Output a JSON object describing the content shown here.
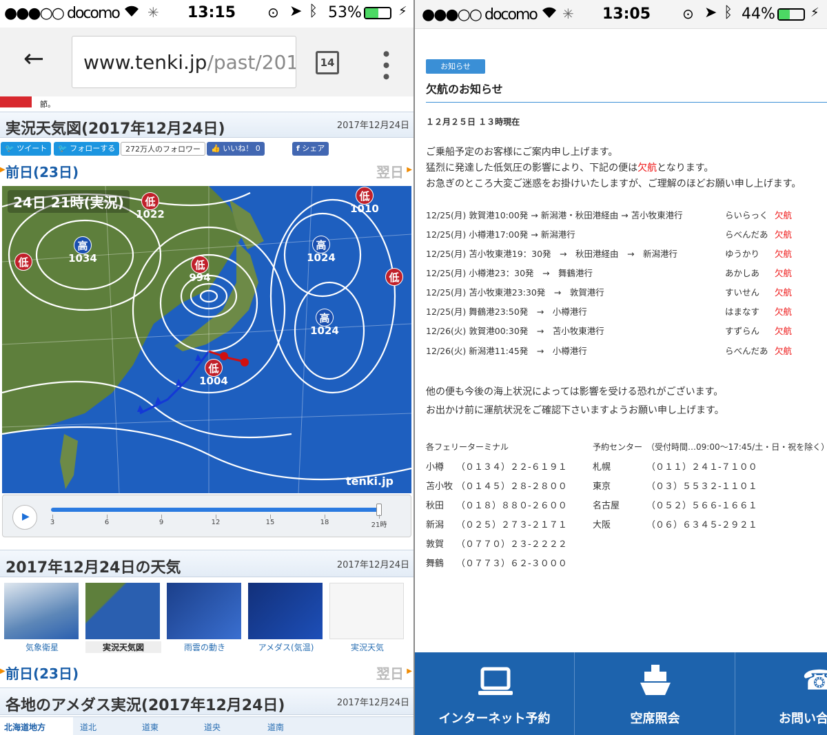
{
  "left_status": {
    "carrier": "●●●○○ docomo",
    "time": "13:15",
    "battery": "53%",
    "battery_level": 0.53
  },
  "browser": {
    "url_host": "www.tenki.jp",
    "url_path": "/past/201",
    "tab_count": "14"
  },
  "partial_line": "節。",
  "section1": {
    "title": "実況天気図(2017年12月24日)",
    "date": "2017年12月24日"
  },
  "social": {
    "tweet": "ツイート",
    "follow": "フォローする",
    "followers": "272万人のフォロワー",
    "like": "いいね！ 0",
    "share": "シェア"
  },
  "nav1": {
    "prev": "前日(23日)",
    "next": "翌日"
  },
  "map": {
    "label": "24日 21時(実況)",
    "watermark": "tenki.jp",
    "systems": [
      {
        "kind": "低",
        "pressure": "1022"
      },
      {
        "kind": "低",
        "pressure": "1010"
      },
      {
        "kind": "高",
        "pressure": "1034"
      },
      {
        "kind": "低",
        "pressure": ""
      },
      {
        "kind": "低",
        "pressure": "994"
      },
      {
        "kind": "高",
        "pressure": "1024"
      },
      {
        "kind": "低",
        "pressure": ""
      },
      {
        "kind": "高",
        "pressure": "1024"
      },
      {
        "kind": "低",
        "pressure": "1004"
      }
    ]
  },
  "slider": {
    "ticks": [
      "3",
      "6",
      "9",
      "12",
      "15",
      "18",
      "21時"
    ],
    "position": 1.0
  },
  "section2": {
    "title": "2017年12月24日の天気",
    "date": "2017年12月24日"
  },
  "thumbnails": [
    "気象衛星",
    "実況天気図",
    "雨雲の動き",
    "アメダス(気温)",
    "実況天気"
  ],
  "nav2": {
    "prev": "前日(23日)",
    "next": "翌日"
  },
  "section3": {
    "title": "各地のアメダス実況(2017年12月24日)",
    "date": "2017年12月24日"
  },
  "region_tabs": [
    "北海道地方",
    "道北",
    "道東",
    "道央",
    "道南"
  ],
  "right_status": {
    "carrier": "●●●○○ docomo",
    "time": "13:05",
    "battery": "44%",
    "battery_level": 0.44
  },
  "notice": {
    "tag": "お知らせ",
    "title": "欠航のお知らせ",
    "as_of": "１２月２５日 １３時現在",
    "intro1": "ご乗船予定のお客様にご案内申し上げます。",
    "intro2_a": "猛烈に発達した低気圧の影響により、下記の便は",
    "intro2_red": "欠航",
    "intro2_b": "となります。",
    "intro3": "お急ぎのところ大変ご迷惑をお掛けいたしますが、ご理解のほどお願い申し上げます。",
    "cancellations": [
      {
        "route": "12/25(月)  敦賀港10:00発 → 新潟港・秋田港経由 → 苫小牧東港行",
        "ship": "らいらっく",
        "status": "欠航"
      },
      {
        "route": "12/25(月)  小樽港17:00発 → 新潟港行",
        "ship": "らべんだあ",
        "status": "欠航"
      },
      {
        "route": "12/25(月)  苫小牧東港19：30発　→　秋田港経由　→　新潟港行",
        "ship": "ゆうかり",
        "status": "欠航"
      },
      {
        "route": "12/25(月)  小樽港23：30発　→　舞鶴港行",
        "ship": "あかしあ",
        "status": "欠航"
      },
      {
        "route": "12/25(月)  苫小牧東港23:30発　→　敦賀港行",
        "ship": "すいせん",
        "status": "欠航"
      },
      {
        "route": "12/25(月)  舞鶴港23:50発　→　小樽港行",
        "ship": "はまなす",
        "status": "欠航"
      },
      {
        "route": "12/26(火)  敦賀港00:30発　→　苫小牧東港行",
        "ship": "すずらん",
        "status": "欠航"
      },
      {
        "route": "12/26(火)  新潟港11:45発　→　小樽港行",
        "ship": "らべんだあ",
        "status": "欠航"
      }
    ],
    "outro1": "他の便も今後の海上状況によっては影響を受ける恐れがございます。",
    "outro2": "お出かけ前に運航状況をご確認下さいますようお願い申し上げます。"
  },
  "contacts": {
    "terminals_title": "各フェリーターミナル",
    "reservation_title": "予約センター　（受付時間…09:00〜17:45/土・日・祝を除く）",
    "terminals": [
      {
        "name": "小樽",
        "tel": "（０１３４）２２-６１９１"
      },
      {
        "name": "苫小牧",
        "tel": "（０１４５）２８-２８００"
      },
      {
        "name": "秋田",
        "tel": "（０１８）８８０-２６００"
      },
      {
        "name": "新潟",
        "tel": "（０２５）２７３-２１７１"
      },
      {
        "name": "敦賀",
        "tel": "（０７７０）２３-２２２２"
      },
      {
        "name": "舞鶴",
        "tel": "（０７７３）６２-３０００"
      }
    ],
    "centers": [
      {
        "name": "札幌",
        "tel": "（０１１）２４１-７１００"
      },
      {
        "name": "東京",
        "tel": "（０３）５５３２-１１０１"
      },
      {
        "name": "名古屋",
        "tel": "（０５２）５６６-１６６１"
      },
      {
        "name": "大阪",
        "tel": "（０６）６３４５-２９２１"
      }
    ]
  },
  "footer": {
    "internet": "インターネット予約",
    "seats": "空席照会",
    "contact": "お問い合"
  }
}
